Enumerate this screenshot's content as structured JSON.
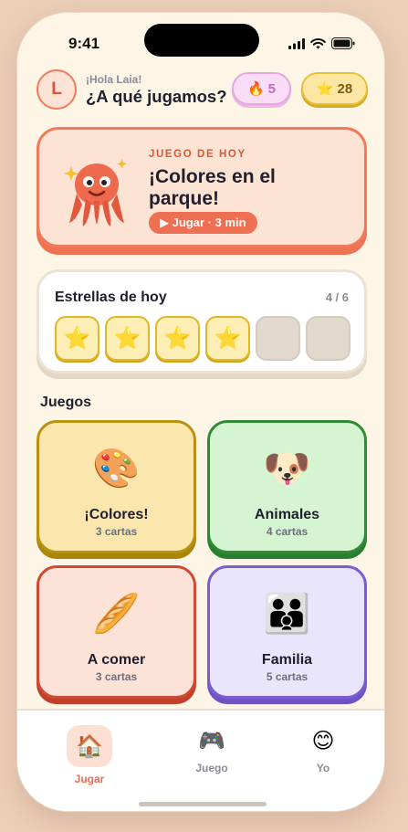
{
  "status": {
    "time": "9:41"
  },
  "header": {
    "avatar_letter": "L",
    "greeting": "¡Hola Laia!",
    "question": "¿A qué jugamos?",
    "streak_icon": "🔥",
    "streak": "5",
    "stars_icon": "⭐",
    "stars": "28"
  },
  "hero": {
    "label": "JUEGO DE HOY",
    "title": "¡Colores en el parque!",
    "button": "▶ Jugar · 3 min",
    "mascot_icon": "octopus-icon"
  },
  "stars_today": {
    "title": "Estrellas de hoy",
    "count": "4 / 6",
    "star_icon": "⭐",
    "earned": 4,
    "total": 6
  },
  "games_section": {
    "title": "Juegos"
  },
  "games": [
    {
      "icon": "🎨",
      "name": "¡Colores!",
      "count": "3 cartas"
    },
    {
      "icon": "🐶",
      "name": "Animales",
      "count": "4 cartas"
    },
    {
      "icon": "🥖",
      "name": "A comer",
      "count": "3 cartas"
    },
    {
      "icon": "👪",
      "name": "Familia",
      "count": "5 cartas"
    }
  ],
  "tabs": [
    {
      "icon": "🏠",
      "label": "Jugar",
      "active": true
    },
    {
      "icon": "🎮",
      "label": "Juego",
      "active": false
    },
    {
      "icon": "😊",
      "label": "Yo",
      "active": false
    }
  ],
  "colors": {
    "accent": "#ef6f52",
    "background": "#fdf5e6",
    "star_gold": "#e0b726"
  }
}
